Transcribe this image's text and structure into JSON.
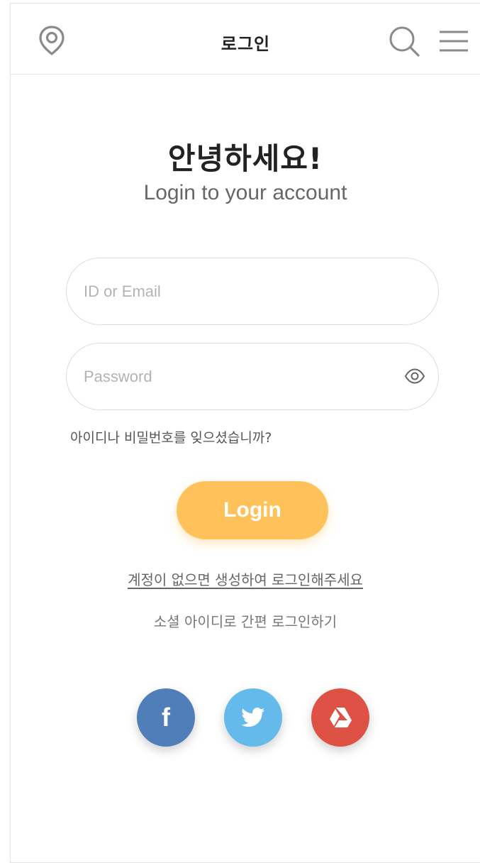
{
  "header": {
    "title": "로그인",
    "icons": [
      "location-pin-icon",
      "search-icon",
      "hamburger-menu-icon"
    ]
  },
  "greeting": {
    "title": "안녕하세요!",
    "subtitle": "Login to your account"
  },
  "form": {
    "id_placeholder": "ID or Email",
    "id_value": "",
    "password_placeholder": "Password",
    "password_value": "",
    "forgot_link": "아이디나 비밀번호를 잊으셨습니까?",
    "login_button": "Login"
  },
  "signup_link": "계정이 없으면 생성하여 로그인해주세요",
  "social": {
    "label": "소셜 아이디로 간편 로그인하기",
    "buttons": [
      {
        "name": "facebook",
        "icon": "facebook-icon",
        "color": "#4f7eb8"
      },
      {
        "name": "twitter",
        "icon": "twitter-icon",
        "color": "#63baeb"
      },
      {
        "name": "google-drive",
        "icon": "google-drive-icon",
        "color": "#de5245"
      }
    ]
  },
  "colors": {
    "accent": "#ffc25a",
    "text": "#222222",
    "border": "#dcdcdc"
  }
}
